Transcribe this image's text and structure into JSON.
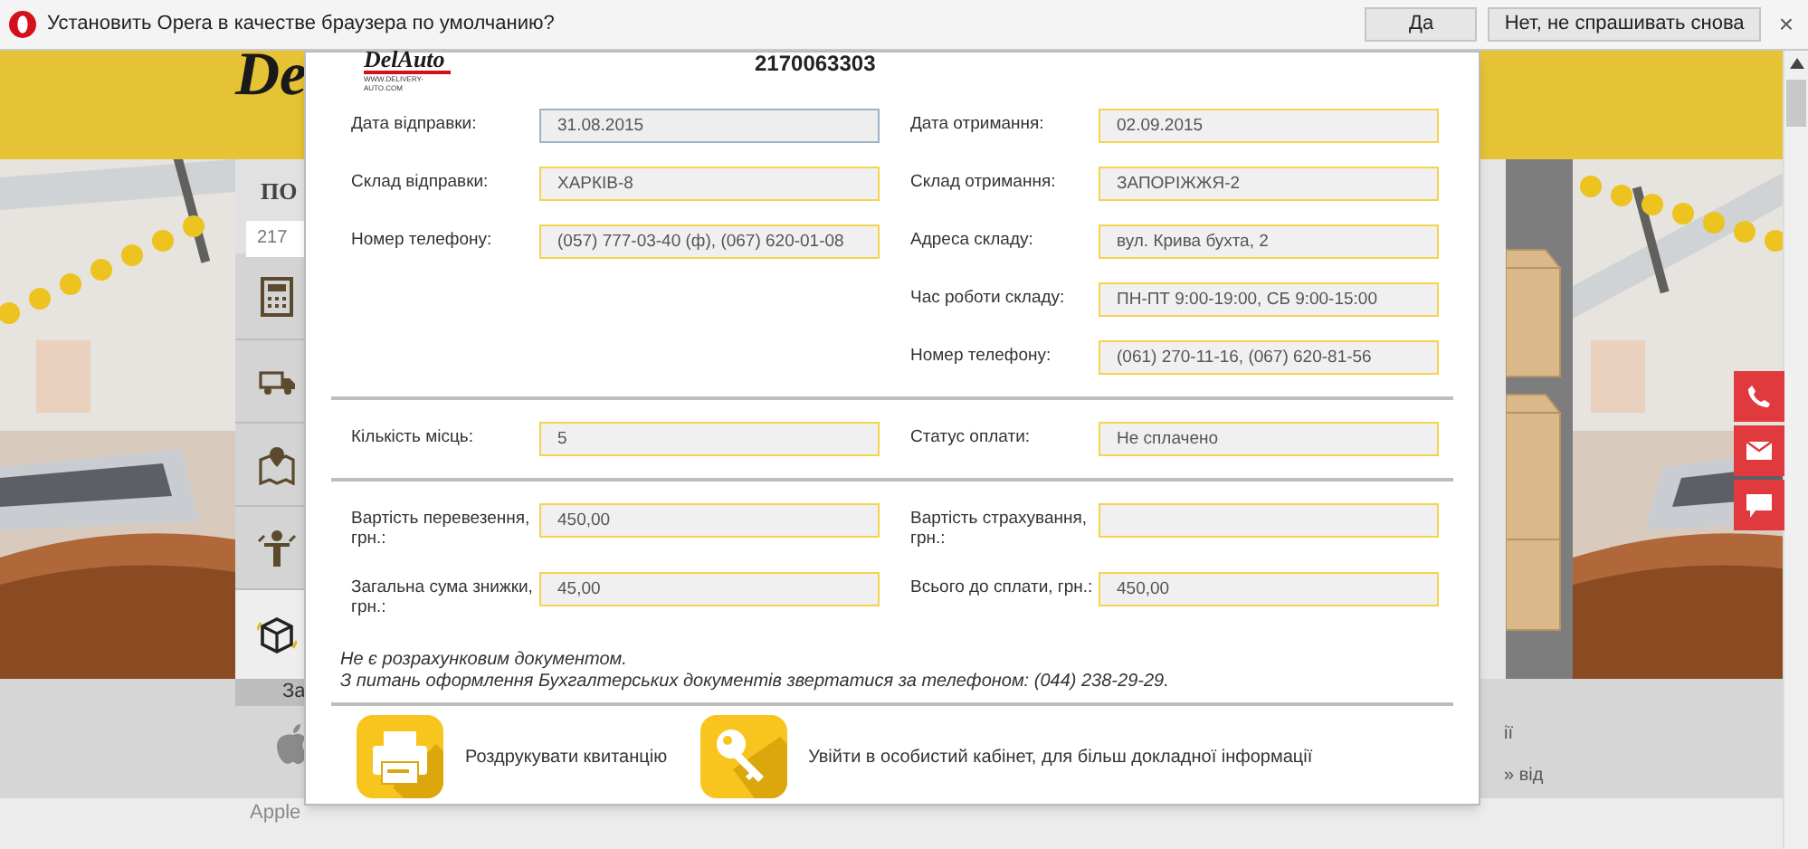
{
  "browser_bar": {
    "message": "Установить Opera в качестве браузера по умолчанию?",
    "buttons": [
      {
        "label": "Да"
      },
      {
        "label": "Нет, не спрашивать снова"
      }
    ],
    "close": "×"
  },
  "background_page": {
    "logo": "De",
    "search_title": "ПО",
    "search_value": "217",
    "sidebar_caption": "За",
    "platform": "Apple",
    "right_texts": [
      "ії",
      "» від"
    ]
  },
  "modal": {
    "logo": {
      "mark": "DelAuto",
      "url": "WWW.DELIVERY-AUTO.COM"
    },
    "number": "2170063303",
    "sections": [
      {
        "left": [
          {
            "label": "Дата відправки:",
            "value": "31.08.2015",
            "focused": true
          },
          {
            "label": "Склад відправки:",
            "value": "ХАРКІВ-8",
            "focused": false
          },
          {
            "label": "Номер телефону:",
            "value": "(057) 777-03-40 (ф), (067) 620-01-08",
            "focused": false
          }
        ],
        "right": [
          {
            "label": "Дата отримання:",
            "value": "02.09.2015",
            "focused": false
          },
          {
            "label": "Склад отримання:",
            "value": "ЗАПОРІЖЖЯ-2",
            "focused": false
          },
          {
            "label": "Адреса складу:",
            "value": "вул. Крива бухта, 2",
            "focused": false
          },
          {
            "label": "Час роботи складу:",
            "value": "ПН-ПТ 9:00-19:00, СБ 9:00-15:00",
            "focused": false
          },
          {
            "label": "Номер телефону:",
            "value": "(061) 270-11-16, (067) 620-81-56",
            "focused": false
          }
        ]
      },
      {
        "left": [
          {
            "label": "Кількість місць:",
            "value": "5",
            "focused": false
          }
        ],
        "right": [
          {
            "label": "Статус оплати:",
            "value": "Не сплачено",
            "focused": false
          }
        ]
      },
      {
        "left": [
          {
            "label": "Вартість перевезення, грн.:",
            "value": "450,00",
            "focused": false
          },
          {
            "label": "Загальна сума знижки, грн.:",
            "value": "45,00",
            "focused": false
          }
        ],
        "right": [
          {
            "label": "Вартість страхування, грн.:",
            "focused": false
          },
          {
            "label": "Всього до сплати, грн.:",
            "value": "450,00",
            "focused": false
          }
        ]
      }
    ],
    "notes": [
      "Не є розрахунковим документом.",
      "З питань оформлення Бухгалтерських документів звертатися за телефоном: (044) 238-29-29."
    ],
    "actions": [
      {
        "kind": "print",
        "label": "Роздрукувати квитанцію"
      },
      {
        "kind": "key",
        "label": "Увійти в особистий кабінет, для більш докладної інформації"
      }
    ]
  }
}
